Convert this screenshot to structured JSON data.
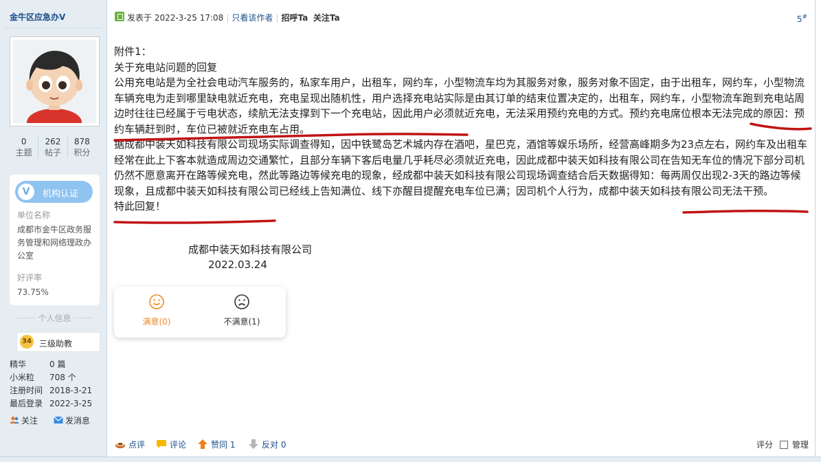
{
  "user": {
    "name": "金牛区应急办V",
    "stats": [
      {
        "value": "0",
        "label": "主题"
      },
      {
        "value": "262",
        "label": "帖子"
      },
      {
        "value": "878",
        "label": "积分"
      }
    ],
    "badge_label": "机构认证",
    "badge_letter": "V",
    "org_label": "单位名称",
    "org_name": "成都市金牛区政务服务管理和网络理政办公室",
    "rating_label": "好评率",
    "rating_value": "73.75%",
    "info_title": "个人信息",
    "rank_level": "34",
    "rank_name": "三级助教",
    "details": [
      {
        "key": "精华",
        "value": "0 篇"
      },
      {
        "key": "小米粒",
        "value": "708 个"
      },
      {
        "key": "注册时间",
        "value": "2018-3-21"
      },
      {
        "key": "最后登录",
        "value": "2022-3-25"
      }
    ],
    "follow_label": "关注",
    "message_label": "发消息"
  },
  "post": {
    "posted_prefix": "发表于 2022-3-25 17:08",
    "only_author": "只看该作者",
    "greet": "招呼Ta",
    "follow": "关注Ta",
    "floor": "5",
    "floor_suffix": "#",
    "lines": [
      "附件1：",
      "关于充电站问题的回复"
    ],
    "paragraph1": "公用充电站是为全社会电动汽车服务的，私家车用户，出租车，网约车，小型物流车均为其服务对象，服务对象不固定，由于出租车，网约车，小型物流车辆充电为走到哪里缺电就近充电，充电呈现出随机性，用户选择充电站实际是由其订单的结束位置决定的，出租车，网约车，小型物流车跑到充电站周边时往往已经属于亏电状态，续航无法支撑到下一个充电站，因此用户必须就近充电，无法采用预约充电的方式。预约充电席位根本无法完成的原因：预约车辆赶到时，车位已被就近充电车占用。",
    "paragraph2": "据成都中装天如科技有限公司现场实际调查得知，因中铁鹭岛艺术城内存在酒吧，星巴克，酒馆等娱乐场所，经营高峰期多为23点左右，网约车及出租车经常在此上下客本就造成周边交通繁忙，且部分车辆下客后电量几乎耗尽必须就近充电，因此成都中装天如科技有限公司在告知无车位的情况下部分司机仍然不愿意离开在路等候充电，然此等路边等候充电的现象，经成都中装天如科技有限公司现场调查结合后天数据得知：每两周仅出现2-3天的路边等候现象，且成都中装天如科技有限公司已经线上告知满位、线下亦醒目提醒充电车位已满；因司机个人行为，成都中装天如科技有限公司无法干预。",
    "closing": "特此回复！",
    "signature_company": "成都中装天如科技有限公司",
    "signature_date": "2022.03.24"
  },
  "rating": {
    "satisfied": "满意(0)",
    "unsatisfied": "不满意(1)",
    "satisfied_color": "#f08a24"
  },
  "footer": {
    "comment_score": "点评",
    "comment": "评论",
    "upvote": "赞同 1",
    "downvote": "反对 0",
    "rate": "评分",
    "manage": "管理"
  }
}
